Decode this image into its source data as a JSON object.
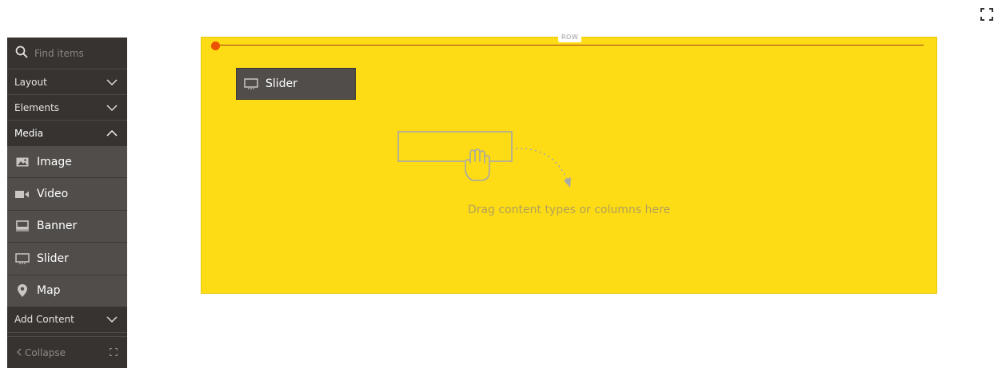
{
  "search": {
    "placeholder": "Find items",
    "value": ""
  },
  "sidebar": {
    "groups": [
      {
        "label": "Layout",
        "state": "collapsed",
        "icon": "chevron-down-icon"
      },
      {
        "label": "Elements",
        "state": "collapsed",
        "icon": "chevron-down-icon"
      },
      {
        "label": "Media",
        "state": "expanded",
        "icon": "chevron-up-icon"
      },
      {
        "label": "Add Content",
        "state": "collapsed",
        "icon": "chevron-down-icon"
      }
    ],
    "media_items": [
      {
        "label": "Image",
        "icon": "image-icon"
      },
      {
        "label": "Video",
        "icon": "video-icon"
      },
      {
        "label": "Banner",
        "icon": "banner-icon"
      },
      {
        "label": "Slider",
        "icon": "slider-icon"
      },
      {
        "label": "Map",
        "icon": "map-pin-icon"
      }
    ],
    "collapse_label": "Collapse"
  },
  "stage": {
    "row_label": "ROW",
    "dragged_item_label": "Slider",
    "dragged_item_icon": "slider-icon",
    "drop_hint": "Drag content types or columns here"
  },
  "colors": {
    "sidebar_bg": "#373330",
    "sidebar_item_bg": "#514d4a",
    "row_bg": "#fddc15",
    "accent": "#eb5202"
  }
}
